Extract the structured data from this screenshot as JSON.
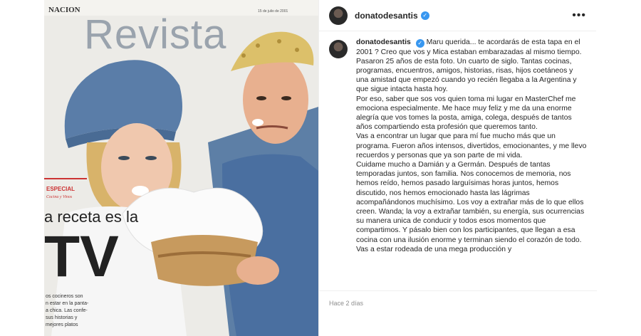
{
  "post": {
    "username": "donatodesantis",
    "verified_icon": "verified-badge-icon",
    "more_icon": "more-options-icon",
    "more_label": "•••",
    "timestamp": "Hace 2 días"
  },
  "caption": {
    "paragraphs": [
      "Maru querida... te acordarás de esta tapa en el 2001 ? Creo que vos y Mica estaban embarazadas al mismo tiempo.",
      "Pasaron 25 años de esta foto. Un cuarto de siglo. Tantas cocinas, programas, encuentros, amigos, historias, risas, hijos coetáneos y una amistad que empezó cuando yo recién llegaba a la Argentina y que sigue intacta hasta hoy.",
      "Por eso, saber que sos vos quien toma mi lugar en MasterChef me emociona especialmente. Me hace muy feliz y me da una enorme alegría que vos tomes la posta, amiga, colega, después de tantos años compartiendo esta profesión que queremos tanto.",
      "Vas a encontrar un lugar que para mí fue mucho más que un programa. Fueron años intensos, divertidos, emocionantes, y me llevo recuerdos y personas que ya son parte de mi vida.",
      "Cuidame mucho a Damián y a Germán. Después de tantas temporadas juntos, son familia. Nos conocemos de memoria, nos hemos reído, hemos pasado larguísimas horas juntos, hemos discutido, nos hemos emocionado hasta las lágrimas acompañándonos muchísimo. Los voy a extrañar más de lo que ellos creen. Wanda; la voy a extrañar también, su energía, sus ocurrencias su manera unica de conducir y todos esos momentos que compartimos. Y pásalo bien con los participantes, que llegan a esa cocina con una ilusión enorme y terminan siendo el corazón de todo. Vas a estar rodeada de una mega producción y"
    ]
  },
  "magazine": {
    "masthead": "Revista",
    "newspaper": "NACION",
    "date": "15 de julio de 2001",
    "section": "ESPECIAL",
    "section_sub": "Cocina y Vinos",
    "headline_1": "a receta es la",
    "headline_2": "TV",
    "body_1": "os cocineros son",
    "body_2": "n estar en la panta-",
    "body_3": "a chica. Las confe-",
    "body_4": "sus historias y",
    "body_5": "mejores platos"
  }
}
